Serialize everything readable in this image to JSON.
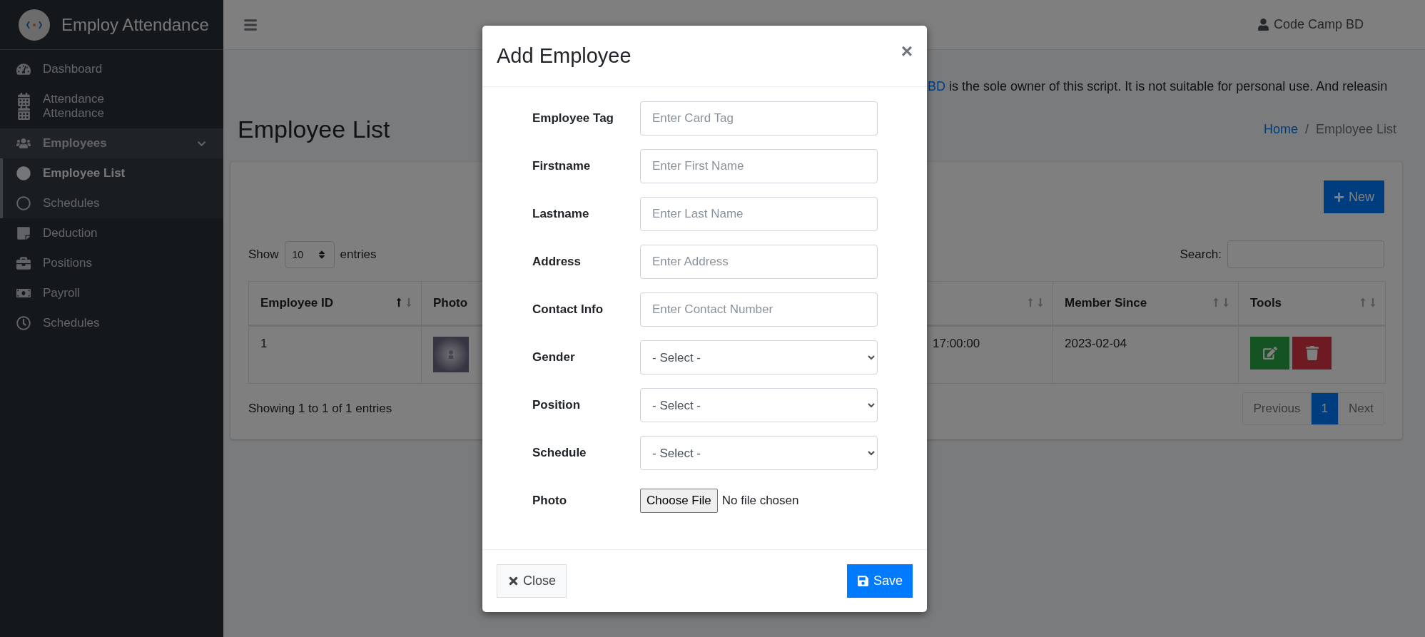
{
  "brand": {
    "title": "Employ Attendance"
  },
  "sidebar": {
    "items": [
      {
        "kind": "link",
        "label": "Dashboard",
        "selected": false
      },
      {
        "kind": "double",
        "labels": [
          "Attendance",
          "Attendance"
        ],
        "selected": false
      },
      {
        "kind": "group",
        "label": "Employees",
        "expanded": true,
        "children": [
          {
            "label": "Employee List",
            "selected": true
          },
          {
            "label": "Schedules",
            "selected": false
          }
        ]
      },
      {
        "kind": "link",
        "label": "Deduction",
        "selected": false
      },
      {
        "kind": "link",
        "label": "Positions",
        "selected": false
      },
      {
        "kind": "link",
        "label": "Payroll",
        "selected": false
      },
      {
        "kind": "link",
        "label": "Schedules",
        "selected": false
      }
    ]
  },
  "navbar": {
    "user": "Code Camp BD"
  },
  "notice": {
    "link": "BD",
    "text": "is the sole owner of this script. It is not suitable for personal use. And releasin"
  },
  "page": {
    "title": "Employee List",
    "breadcrumb_separator": "/",
    "breadcrumb": [
      {
        "label": "Home",
        "kind": "link"
      },
      {
        "label": "Employee List",
        "kind": "current"
      }
    ]
  },
  "card": {
    "new_button": "New",
    "show_label": "Show",
    "page_size": "10",
    "entries_label": "entries",
    "search_label": "Search:",
    "table": {
      "columns": [
        {
          "label": "Employee ID",
          "sortable": true,
          "sorted": true
        },
        {
          "label": "Photo"
        },
        {
          "sortable": true,
          "sorted": false
        },
        {
          "label": "Member Since",
          "sortable": true,
          "sorted": false
        },
        {
          "label": "Tools",
          "sortable": true,
          "sorted": false
        }
      ],
      "rows": [
        {
          "employee_id": "1",
          "column_3": "17:00:00",
          "member_since": "2023-02-04"
        }
      ]
    },
    "info": "Showing 1 to 1 of 1 entries",
    "pagination": [
      {
        "label": "Previous",
        "selected": false
      },
      {
        "label": "1",
        "selected": true
      },
      {
        "label": "Next",
        "selected": false
      }
    ]
  },
  "modal": {
    "title": "Add Employee",
    "close_symbol": "×",
    "fields": [
      {
        "kind": "text",
        "label": "Employee Tag",
        "placeholder": "Enter Card Tag"
      },
      {
        "kind": "text",
        "label": "Firstname",
        "placeholder": "Enter First Name"
      },
      {
        "kind": "text",
        "label": "Lastname",
        "placeholder": "Enter Last Name"
      },
      {
        "kind": "text",
        "label": "Address",
        "placeholder": "Enter Address"
      },
      {
        "kind": "text",
        "label": "Contact Info",
        "placeholder": "Enter Contact Number"
      },
      {
        "kind": "select",
        "label": "Gender",
        "value": "- Select -"
      },
      {
        "kind": "select",
        "label": "Position",
        "value": "- Select -"
      },
      {
        "kind": "select",
        "label": "Schedule",
        "value": "- Select -"
      },
      {
        "kind": "file",
        "label": "Photo",
        "button": "Choose File",
        "status": "No file chosen"
      }
    ],
    "close_button": "Close",
    "save_button": "Save"
  }
}
